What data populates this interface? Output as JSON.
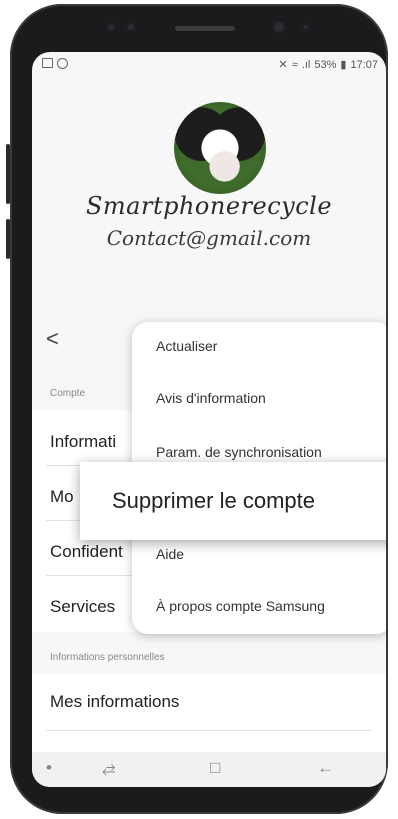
{
  "status": {
    "notifications": [
      "gallery-icon",
      "circle-icon"
    ],
    "mute": "✕",
    "wifi": "≈",
    "signal": ".ıl",
    "battery_percent": "53%",
    "battery": "▮",
    "time": "17:07"
  },
  "profile": {
    "name": "Smartphonerecycle",
    "email": "Contact@gmail.com"
  },
  "back_label": "<",
  "sections": {
    "account_label": "Compte",
    "personal_label": "Informations personnelles"
  },
  "account_items": [
    {
      "label": "Informati"
    },
    {
      "label": "Mo"
    },
    {
      "label": "Confident"
    },
    {
      "label": "Services"
    }
  ],
  "personal_items": [
    {
      "label": "Mes informations"
    }
  ],
  "menu": {
    "items": [
      {
        "label": "Actualiser"
      },
      {
        "label": "Avis d'information"
      },
      {
        "label": "Param. de synchronisation"
      },
      {
        "label": "Aide"
      },
      {
        "label": "À propos compte Samsung"
      }
    ]
  },
  "highlighted_action": {
    "label": "Supprimer le compte"
  },
  "navbar": {
    "dot": "•",
    "recent": "⥄",
    "home": "□",
    "back": "←"
  }
}
